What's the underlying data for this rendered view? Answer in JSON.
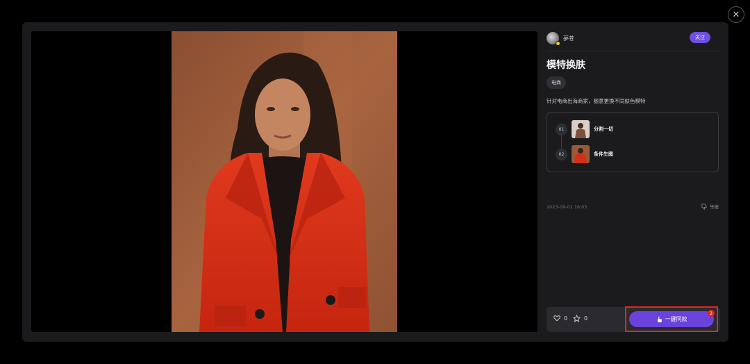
{
  "author": {
    "name": "夢苍"
  },
  "follow_label": "关注",
  "template": {
    "title": "模特换肤",
    "tag": "电商",
    "description": "针对电商出海商家，随意更换不同肤色模特",
    "steps": [
      {
        "num": "01",
        "label": "分割一切"
      },
      {
        "num": "02",
        "label": "条件生图"
      }
    ],
    "date": "2023-09-01 16:05",
    "report_label": "举报"
  },
  "stats": {
    "likes": "0",
    "favorites": "0"
  },
  "use_button": {
    "label": "一键同款",
    "badge": "2"
  },
  "colors": {
    "accent": "#6a42dc",
    "highlight": "#e1271f",
    "coat": "#d62e17",
    "backdrop": "#9a5a3a"
  },
  "icons": [
    "close-icon",
    "heart-icon",
    "star-icon",
    "hand-pointer-icon",
    "thumbs-down-icon"
  ]
}
